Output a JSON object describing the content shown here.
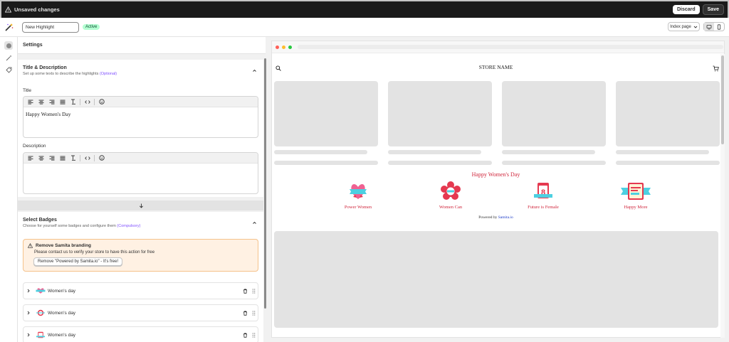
{
  "topbar": {
    "title": "Unsaved changes",
    "discard_label": "Discard",
    "save_label": "Save"
  },
  "subbar": {
    "name_value": "New Highlight",
    "status_badge": "Active",
    "page_select": "Index page"
  },
  "panel": {
    "header": "Settings",
    "title_section": {
      "heading": "Title & Description",
      "subtitle": "Set up some texts to describe the highlights",
      "subtitle_tag": "(Optional)",
      "title_label": "Title",
      "title_value": "Happy Women's Day",
      "description_label": "Description",
      "description_value": ""
    },
    "badges_section": {
      "heading": "Select Badges",
      "subtitle": "Choose for yourself some badges and configure them",
      "subtitle_tag": "(Compulsory)",
      "branding": {
        "title": "Remove Samita branding",
        "text": "Please contact us to verify your store to have this action for free",
        "button": "Remove \"Powered by Samita.io\" - It's free!"
      },
      "items": [
        {
          "label": "Women's day"
        },
        {
          "label": "Women's day"
        },
        {
          "label": "Women's day"
        }
      ]
    }
  },
  "preview": {
    "store_name": "STORE NAME",
    "highlight_title": "Happy Women's Day",
    "highlights": [
      {
        "caption": "Power Women",
        "icon": "heart-ribbon-icon"
      },
      {
        "caption": "Women Can",
        "icon": "flower-badge-icon"
      },
      {
        "caption": "Future is Female",
        "icon": "calendar-8-icon"
      },
      {
        "caption": "Happy More",
        "icon": "ribbon-card-icon"
      }
    ],
    "powered_prefix": "Powered by",
    "powered_link": "Samita.io"
  },
  "colors": {
    "accent_red": "#d0263c",
    "save_bg": "#303030",
    "active_bg": "#b4fed2",
    "warning_bg": "#fff1e3"
  }
}
